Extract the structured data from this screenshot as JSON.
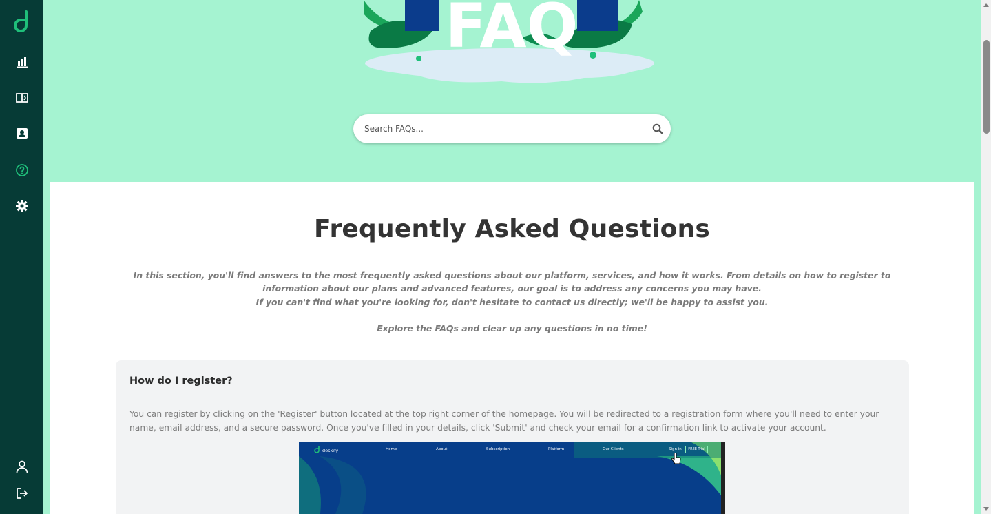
{
  "sidebar": {
    "logo": "d",
    "items": [
      {
        "icon": "bar-chart-icon",
        "label": "Dashboard"
      },
      {
        "icon": "book-icon",
        "label": "Library"
      },
      {
        "icon": "contact-card-icon",
        "label": "Contacts"
      },
      {
        "icon": "help-circle-icon",
        "label": "FAQ",
        "active": true
      },
      {
        "icon": "gear-icon",
        "label": "Settings"
      }
    ],
    "bottom_items": [
      {
        "icon": "user-icon"
      },
      {
        "icon": "logout-icon"
      }
    ]
  },
  "hero": {
    "illustration_text": "FAQ",
    "search_placeholder": "Search FAQs..."
  },
  "main": {
    "title": "Frequently Asked Questions",
    "intro": [
      "In this section, you'll find answers to the most frequently asked questions about our platform, services, and how it works. From details on how to register to information about our plans and advanced features, our goal is to address any concerns you may have.",
      "If you can't find what you're looking for, don't hesitate to contact us directly; we'll be happy to assist you.",
      "Explore the FAQs and clear up any questions in no time!"
    ],
    "faqs": [
      {
        "question": "How do I register?",
        "answer": "You can register by clicking on the 'Register' button located at the top right corner of the homepage. You will be redirected to a registration form where you'll need to enter your name, email address, and a secure password. Once you've filled in your details, click 'Submit' and check your email for a confirmation link to activate your account.",
        "screenshot": {
          "brand": "deskify",
          "nav": [
            "Home",
            "About",
            "Subscription",
            "Platform",
            "Our Clients",
            "Sign in"
          ],
          "trial_button": "FREE Trial"
        }
      }
    ]
  },
  "colors": {
    "sidebar_bg": "#063b36",
    "accent": "#1fbf7a",
    "hero_bg": "#a5f3d1",
    "card_bg": "#f2f3f4"
  }
}
